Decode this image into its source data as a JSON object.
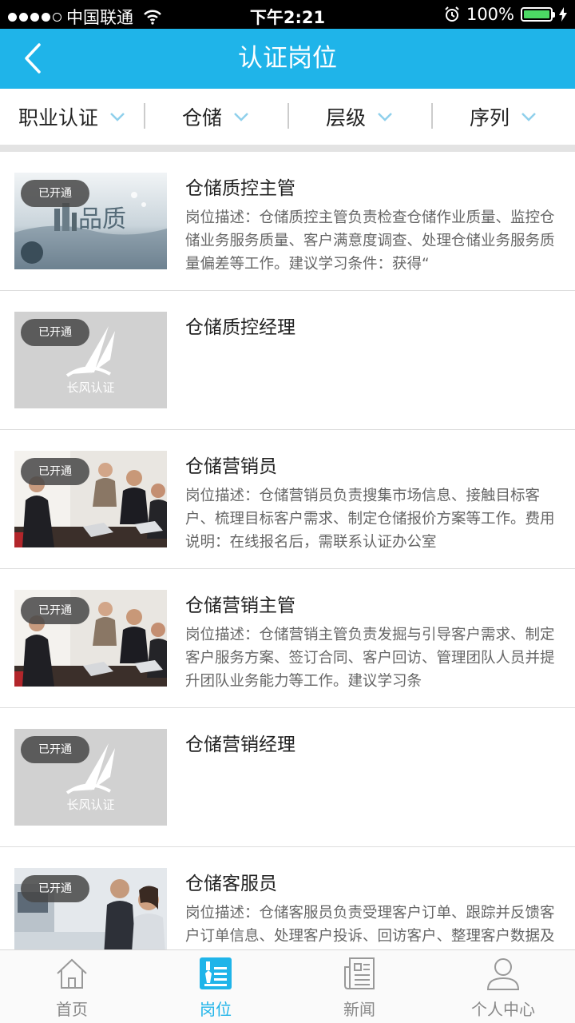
{
  "status_bar": {
    "carrier": "中国联通",
    "time": "下午2:21",
    "battery_text": "100%",
    "battery_level": 1.0,
    "icons": [
      "signal-icon",
      "wifi-icon",
      "alarm-icon",
      "battery-icon",
      "charging-icon"
    ]
  },
  "nav": {
    "title": "认证岗位",
    "back_icon": "chevron-left-icon"
  },
  "filters": [
    {
      "label": "职业认证"
    },
    {
      "label": "仓储"
    },
    {
      "label": "层级"
    },
    {
      "label": "序列"
    }
  ],
  "items": [
    {
      "badge": "已开通",
      "title": "仓储质控主管",
      "desc": "岗位描述：仓储质控主管负责检查仓储作业质量、监控仓储业务服务质量、客户满意度调查、处理仓储业务服务质量偏差等工作。建议学习条件：获得“",
      "thumb": "quality-image"
    },
    {
      "badge": "已开通",
      "title": "仓储质控经理",
      "desc": "",
      "thumb": "logo-placeholder",
      "logo_text": "长风认证"
    },
    {
      "badge": "已开通",
      "title": "仓储营销员",
      "desc": "岗位描述：仓储营销员负责搜集市场信息、接触目标客户、梳理目标客户需求、制定仓储报价方案等工作。费用说明：在线报名后，需联系认证办公室",
      "thumb": "office-meeting-image"
    },
    {
      "badge": "已开通",
      "title": "仓储营销主管",
      "desc": "岗位描述：仓储营销主管负责发掘与引导客户需求、制定客户服务方案、签订合同、客户回访、管理团队人员并提升团队业务能力等工作。建议学习条",
      "thumb": "office-meeting-image"
    },
    {
      "badge": "已开通",
      "title": "仓储营销经理",
      "desc": "",
      "thumb": "logo-placeholder",
      "logo_text": "长风认证"
    },
    {
      "badge": "已开通",
      "title": "仓储客服员",
      "desc": "岗位描述：仓储客服员负责受理客户订单、跟踪并反馈客户订单信息、处理客户投诉、回访客户、整理客户数据及客户档案等工作。费用说明：在线报",
      "thumb": "call-center-image"
    }
  ],
  "tabs": [
    {
      "label": "首页",
      "icon": "home-icon",
      "active": false
    },
    {
      "label": "岗位",
      "icon": "position-icon",
      "active": true
    },
    {
      "label": "新闻",
      "icon": "news-icon",
      "active": false
    },
    {
      "label": "个人中心",
      "icon": "user-icon",
      "active": false
    }
  ],
  "colors": {
    "primary": "#1fb4e9",
    "tab_inactive": "#888888",
    "battery": "#4cd964"
  }
}
